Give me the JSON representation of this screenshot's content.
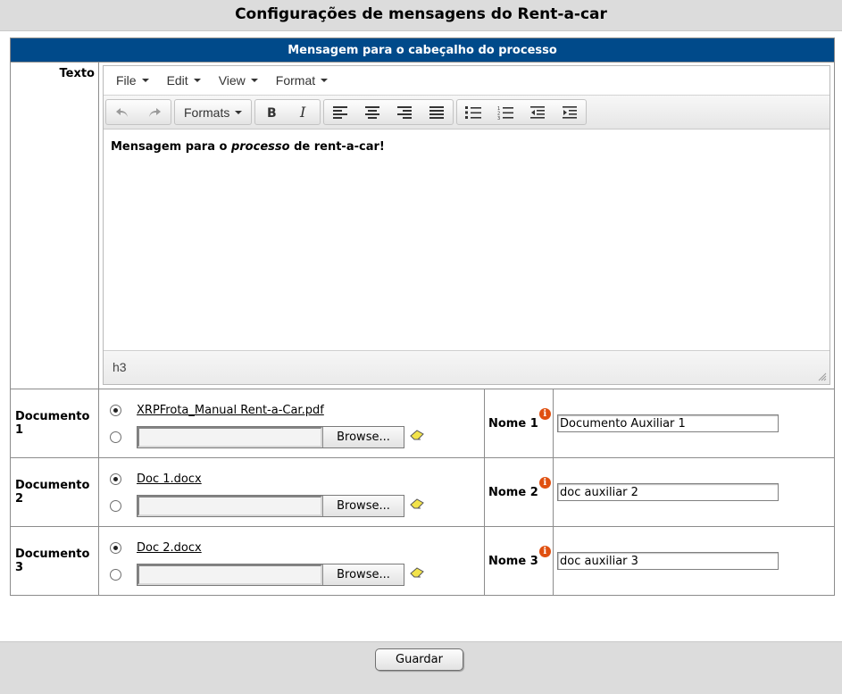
{
  "page": {
    "title": "Configurações de mensagens do Rent-a-car"
  },
  "section": {
    "header": "Mensagem para o cabeçalho do processo",
    "texto_label": "Texto"
  },
  "editor": {
    "menu": [
      "File",
      "Edit",
      "View",
      "Format"
    ],
    "formats_label": "Formats",
    "content": {
      "part1": "Mensagem para o ",
      "italic": "processo",
      "part2": " de rent-a-car!"
    },
    "status_path": "h3",
    "toolbar_icons": [
      "undo-icon",
      "redo-icon",
      "bold-icon",
      "italic-icon",
      "align-left-icon",
      "align-center-icon",
      "align-right-icon",
      "align-justify-icon",
      "bullet-list-icon",
      "numbered-list-icon",
      "outdent-icon",
      "indent-icon"
    ]
  },
  "documents": [
    {
      "label": "Documento 1",
      "file": "XRPFrota_Manual Rent-a-Car.pdf",
      "browse": "Browse...",
      "nome_label": "Nome 1",
      "nome_value": "Documento Auxiliar 1"
    },
    {
      "label": "Documento 2",
      "file": "Doc 1.docx",
      "browse": "Browse...",
      "nome_label": "Nome 2",
      "nome_value": "doc auxiliar 2"
    },
    {
      "label": "Documento 3",
      "file": "Doc 2.docx",
      "browse": "Browse...",
      "nome_label": "Nome 3",
      "nome_value": "doc auxiliar 3"
    }
  ],
  "footer": {
    "save_label": "Guardar"
  },
  "colors": {
    "header_bg": "#004a8a",
    "info_icon": "#e05010"
  }
}
